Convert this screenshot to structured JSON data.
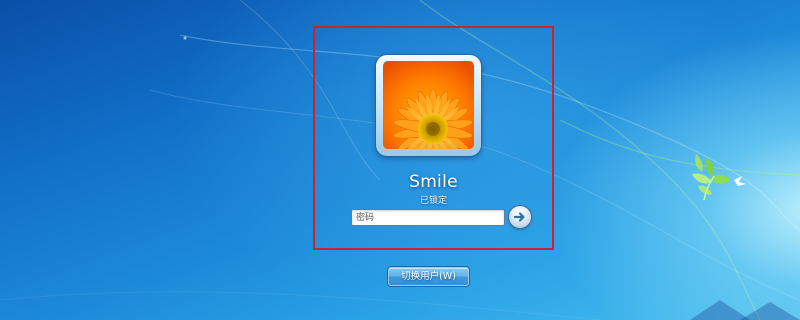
{
  "user": {
    "name": "Smile",
    "status": "已锁定"
  },
  "login": {
    "password_placeholder": "密码",
    "submit_icon": "arrow-right-icon"
  },
  "switch_user": {
    "label": "切换用户(W)"
  },
  "colors": {
    "highlight_border": "#d21f2b",
    "wallpaper_dark": "#0a4fa8",
    "wallpaper_light": "#4bc0ef"
  }
}
